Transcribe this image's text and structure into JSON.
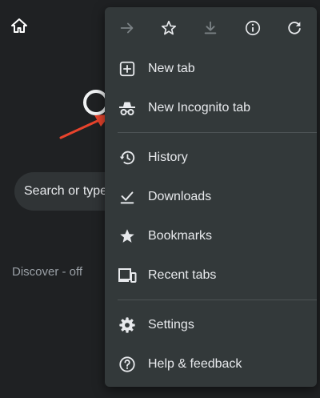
{
  "background": {
    "search_placeholder": "Search or type",
    "discover_label": "Discover - off"
  },
  "toolbar": {
    "icons": [
      "forward-icon",
      "bookmark-star-icon",
      "download-icon",
      "info-icon",
      "refresh-icon"
    ]
  },
  "menu": {
    "new_tab": "New tab",
    "new_incognito_tab": "New Incognito tab",
    "history": "History",
    "downloads": "Downloads",
    "bookmarks": "Bookmarks",
    "recent_tabs": "Recent tabs",
    "settings": "Settings",
    "help_feedback": "Help & feedback"
  },
  "colors": {
    "page_bg": "#1f2123",
    "menu_bg": "#33393a",
    "text": "#e8eaed",
    "muted": "#9aa0a6",
    "annotation_arrow": "#e8432c"
  }
}
